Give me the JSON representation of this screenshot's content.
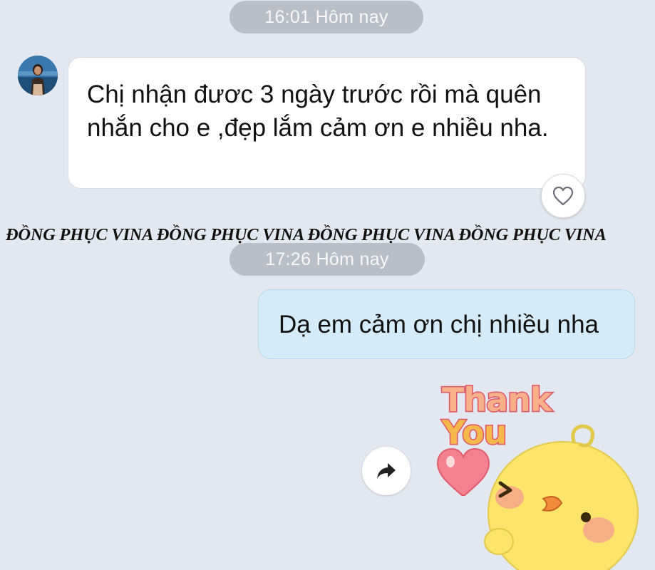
{
  "chat": {
    "time_header_1": "16:01 Hôm nay",
    "time_header_2": "17:26 Hôm nay",
    "incoming_message": "Chị nhận đươc 3 ngày trước rồi mà quên nhắn cho e ,đẹp lắm cảm ơn e nhiều nha.",
    "outgoing_message": "Dạ em cảm ơn chị nhiều nha"
  },
  "watermark": "ĐỒNG PHỤC VINA ĐỒNG PHỤC VINA ĐỒNG PHỤC VINA ĐỒNG PHỤC VINA",
  "sticker": {
    "line1": "Thank",
    "line2": "You"
  },
  "icons": {
    "reaction": "heart-icon",
    "share": "share-arrow-icon",
    "avatar": "user-avatar"
  },
  "colors": {
    "background": "#e3e7ef",
    "time_pill": "#b9bec7",
    "incoming_bubble": "#ffffff",
    "outgoing_bubble": "#d4ecf9"
  }
}
